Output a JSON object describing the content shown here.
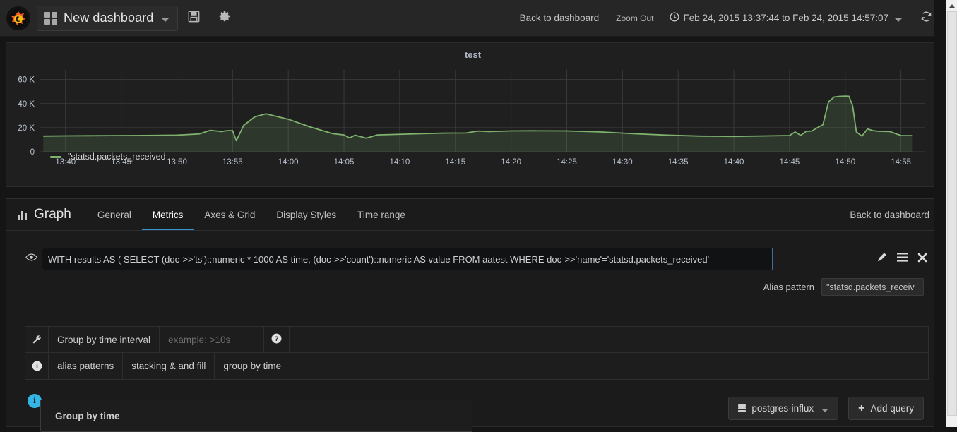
{
  "topnav": {
    "logo_icon": "grafana-logo-icon",
    "grid_icon": "grid-icon",
    "dashboard_title": "New dashboard",
    "save_icon": "save-icon",
    "settings_icon": "gear-icon",
    "back_to_dashboard": "Back to dashboard",
    "zoom_out": "Zoom Out",
    "clock_icon": "clock-icon",
    "time_range": "Feb 24, 2015 13:37:44 to Feb 24, 2015 14:57:07",
    "refresh_icon": "refresh-icon"
  },
  "panel": {
    "title": "test",
    "legend_label": "\"statsd.packets_received",
    "series_color": "#7eb26d"
  },
  "chart_data": {
    "type": "line",
    "title": "test",
    "xlabel": "",
    "ylabel": "",
    "grid": true,
    "legend_position": "bottom-left",
    "xtick_labels": [
      "13:40",
      "13:45",
      "13:50",
      "13:55",
      "14:00",
      "14:05",
      "14:10",
      "14:15",
      "14:20",
      "14:25",
      "14:30",
      "14:35",
      "14:40",
      "14:45",
      "14:50",
      "14:55"
    ],
    "ytick_labels": [
      "0",
      "20 K",
      "40 K",
      "60 K"
    ],
    "ytick_values": [
      0,
      20000,
      40000,
      60000
    ],
    "ylim": [
      0,
      68000
    ],
    "xlim": [
      "13:37:44",
      "14:57:07"
    ],
    "series": [
      {
        "name": "\"statsd.packets_received",
        "color": "#7eb26d",
        "fill": true,
        "x": [
          "13:38",
          "13:40",
          "13:42",
          "13:44",
          "13:46",
          "13:48",
          "13:50",
          "13:52",
          "13:53",
          "13:54",
          "13:54:30",
          "13:55",
          "13:55:20",
          "13:56",
          "13:57",
          "13:58",
          "14:00",
          "14:02",
          "14:04",
          "14:05",
          "14:05:30",
          "14:06",
          "14:07",
          "14:08",
          "14:10",
          "14:12",
          "14:14",
          "14:16",
          "14:17",
          "14:18",
          "14:20",
          "14:22",
          "14:25",
          "14:28",
          "14:31",
          "14:34",
          "14:37",
          "14:40",
          "14:43",
          "14:45",
          "14:45:30",
          "14:46",
          "14:46:30",
          "14:47",
          "14:47:30",
          "14:48",
          "14:48:30",
          "14:49",
          "14:49:30",
          "14:50",
          "14:50:20",
          "14:50:40",
          "14:51",
          "14:51:30",
          "14:52",
          "14:52:30",
          "14:53",
          "14:54",
          "14:55",
          "14:56"
        ],
        "y": [
          13000,
          13200,
          13300,
          13400,
          13500,
          13600,
          13800,
          14800,
          17800,
          16800,
          17500,
          17600,
          9200,
          22000,
          29000,
          31500,
          27000,
          20500,
          15000,
          14000,
          11500,
          13800,
          11300,
          14000,
          14500,
          15000,
          15500,
          15600,
          17200,
          16800,
          17300,
          17400,
          17300,
          16500,
          15000,
          13800,
          13000,
          12800,
          13200,
          13500,
          16500,
          13600,
          17000,
          17200,
          20000,
          22500,
          41500,
          45500,
          46000,
          46200,
          46100,
          38000,
          16500,
          13000,
          19000,
          17500,
          17000,
          16800,
          13500,
          13400
        ]
      }
    ]
  },
  "editor": {
    "header_icon": "bar-chart-icon",
    "header_label": "Graph",
    "tabs": [
      {
        "label": "General",
        "active": false
      },
      {
        "label": "Metrics",
        "active": true
      },
      {
        "label": "Axes & Grid",
        "active": false
      },
      {
        "label": "Display Styles",
        "active": false
      },
      {
        "label": "Time range",
        "active": false
      }
    ],
    "back_to_dashboard": "Back to dashboard",
    "query": {
      "eye_icon": "eye-icon",
      "value": "WITH results AS ( SELECT (doc->>'ts')::numeric * 1000 AS time, (doc->>'count')::numeric AS value FROM aatest WHERE doc->>'name'='statsd.packets_received'",
      "edit_icon": "pencil-icon",
      "menu_icon": "hamburger-icon",
      "remove_icon": "close-icon"
    },
    "alias": {
      "label": "Alias pattern",
      "value": "\"statsd.packets_receiv"
    },
    "group_by": {
      "wrench_icon": "wrench-icon",
      "label": "Group by time interval",
      "placeholder": "example: >10s",
      "value": "",
      "help_icon": "question-circle-icon"
    },
    "docs": {
      "info_icon": "info-circle-icon",
      "links": [
        "alias patterns",
        "stacking & and fill",
        "group by time"
      ]
    },
    "popover": {
      "info_icon": "info-circle-icon",
      "title": "Group by time"
    },
    "datasource_button": {
      "icon": "database-icon",
      "label": "postgres-influx",
      "caret_icon": "chevron-down-icon"
    },
    "add_query_button": {
      "icon": "plus-icon",
      "label": "Add query"
    }
  },
  "scrollbar": {
    "up_arrow_icon": "chevron-up-icon",
    "grip_icon": "grip-icon"
  },
  "colors": {
    "accent": "#3495d7",
    "series_green": "#7eb26d",
    "info_blue": "#33b5e5",
    "panel_bg": "#1f1f20",
    "app_bg": "#151515"
  }
}
